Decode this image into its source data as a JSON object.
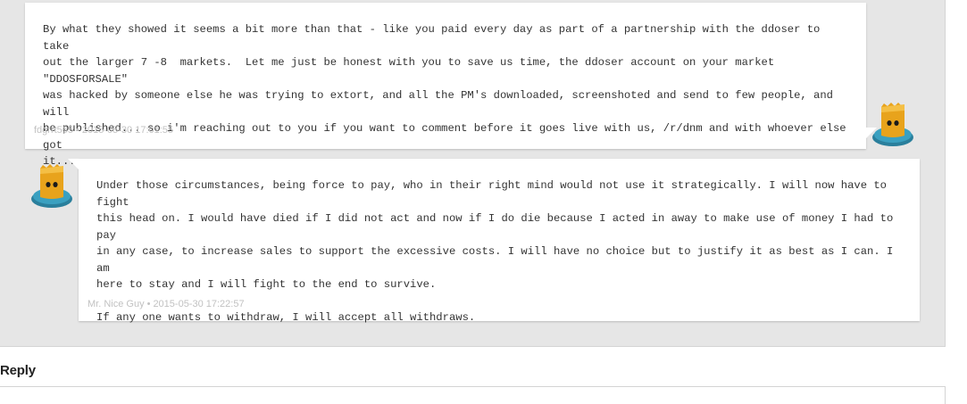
{
  "messages": [
    {
      "text": "By what they showed it seems a bit more than that - like you paid every day as part of a partnership with the ddoser to take\nout the larger 7 -8  markets.  Let me just be honest with you to save us time, the ddoser account on your market \"DDOSFORSALE\"\nwas hacked by someone else he was trying to extort, and all the PM's downloaded, screenshoted and send to few people, and will\nbe published... so i'm reaching out to you if you want to comment before it goes live with us, /r/dnm and with whoever else got\nit...",
      "author": "fdgrrt565",
      "separator": "•",
      "timestamp": "2015-05-30 17:01:55",
      "avatar_icon": "paper-bag-avatar-icon"
    },
    {
      "text": "Under those circumstances, being force to pay, who in their right mind would not use it strategically. I will now have to fight\nthis head on. I would have died if I did not act and now if I do die because I acted in away to make use of money I had to pay\nin any case, to increase sales to support the excessive costs. I will have no choice but to justify it as best as I can. I am\nhere to stay and I will fight to the end to survive.\n\nIf any one wants to withdraw, I will accept all withdraws.",
      "author": "Mr. Nice Guy",
      "separator": "•",
      "timestamp": "2015-05-30 17:22:57",
      "avatar_icon": "paper-bag-avatar-icon"
    }
  ],
  "reply": {
    "title": "Reply"
  },
  "colors": {
    "thread_background": "#e6e6e6",
    "bubble_background": "#ffffff",
    "meta_text": "#c2c2c2",
    "avatar_bag": "#e8a31c",
    "avatar_base": "#2e8fae"
  }
}
